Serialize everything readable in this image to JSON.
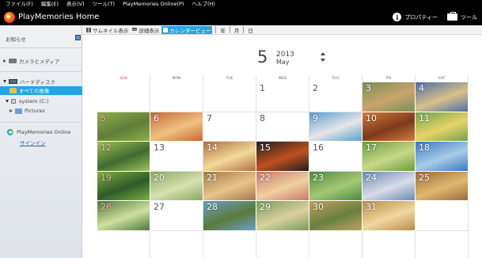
{
  "menu": [
    "ファイル(F)",
    "編集(E)",
    "表示(V)",
    "ツール(T)",
    "PlayMemories Online(P)",
    "ヘルプ(H)"
  ],
  "app": {
    "title": "PlayMemories Home",
    "properties_label": "プロパティー",
    "tools_label": "ツール"
  },
  "sidebar": {
    "notifications": "お知らせ",
    "camera_media": "カメラとメディア",
    "hard_disk": "ハードディスク",
    "all_images": "すべての画像",
    "system_drive": "system (C:)",
    "pictures": "Pictures",
    "pm_online": "PlayMemories Online",
    "sign_in": "サインイン"
  },
  "toolbar": {
    "views": [
      "サムネイル表示",
      "詳細表示",
      "カレンダービュー"
    ],
    "active_view": "カレンダービュー",
    "periods": [
      "年",
      "月",
      "日"
    ]
  },
  "calendar": {
    "day_number": "5",
    "year": "2013",
    "month": "May",
    "weekdays": [
      "SUN",
      "MON",
      "TUE",
      "WED",
      "THU",
      "FRI",
      "SAT"
    ],
    "first_weekday_index": 3,
    "days_in_month": 31,
    "photo_days": [
      3,
      4,
      5,
      6,
      9,
      10,
      11,
      12,
      14,
      15,
      17,
      18,
      19,
      20,
      21,
      22,
      23,
      24,
      25,
      26,
      28,
      29,
      30,
      31
    ]
  },
  "colors": {
    "accent": "#1ea6e6",
    "sunday": "#e84848"
  }
}
